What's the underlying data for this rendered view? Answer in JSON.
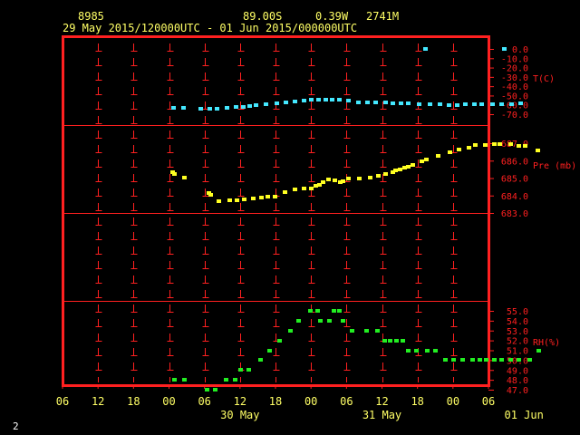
{
  "header": {
    "station": "8985",
    "lat": "89.00S",
    "lon": "0.39W",
    "elev": "2741M",
    "period": "29 May 2015/120000UTC - 01 Jun 2015/000000UTC"
  },
  "footer": {
    "page_number": "2"
  },
  "colors": {
    "frame": "#ff2020",
    "axis_text": "#ffff66",
    "tick_marks": "#ff2020",
    "temp": "#44e8ff",
    "pressure": "#ffff22",
    "rh": "#22ee22",
    "corner_text": "#ffffff"
  },
  "chart_data": {
    "type": "scatter",
    "x_axis": {
      "range_hours": [
        -6,
        66
      ],
      "tick_hours": [
        -6,
        0,
        6,
        12,
        18,
        24,
        30,
        36,
        42,
        48,
        54,
        60,
        66
      ],
      "tick_labels": [
        "06",
        "12",
        "18",
        "00",
        "06",
        "12",
        "18",
        "00",
        "06",
        "12",
        "18",
        "00",
        "06"
      ],
      "day_labels": [
        {
          "label": "30 May",
          "hour": 24
        },
        {
          "label": "31 May",
          "hour": 48
        },
        {
          "label": "01 Jun",
          "hour": 72
        }
      ]
    },
    "panels": [
      {
        "id": "temp",
        "label": "T(C)",
        "ylim": [
          -75,
          5
        ],
        "ticks": [
          0,
          -10,
          -20,
          -30,
          -40,
          -50,
          -60,
          -70
        ],
        "tick_labels": [
          "0.0",
          "-10.0",
          "-20.0",
          "-30.0",
          "-40.0",
          "-50.0",
          "-60.0",
          "-70.0"
        ],
        "points": [
          [
            12.7,
            -63.5
          ],
          [
            14.4,
            -63.5
          ],
          [
            17.3,
            -64.5
          ],
          [
            18.8,
            -64.5
          ],
          [
            20.1,
            -64
          ],
          [
            21.8,
            -63.5
          ],
          [
            23.2,
            -62.5
          ],
          [
            24.5,
            -62
          ],
          [
            25.5,
            -61.5
          ],
          [
            26.7,
            -60.5
          ],
          [
            28.3,
            -59.5
          ],
          [
            30.1,
            -58
          ],
          [
            31.7,
            -57
          ],
          [
            33.2,
            -56
          ],
          [
            34.8,
            -55
          ],
          [
            36.0,
            -54.5
          ],
          [
            37.2,
            -54
          ],
          [
            38.4,
            -54.5
          ],
          [
            39.5,
            -54.5
          ],
          [
            40.7,
            -54.5
          ],
          [
            42.2,
            -55.5
          ],
          [
            43.9,
            -57
          ],
          [
            45.5,
            -57
          ],
          [
            46.9,
            -57
          ],
          [
            48.5,
            -57.5
          ],
          [
            49.8,
            -58
          ],
          [
            51.2,
            -58
          ],
          [
            52.4,
            -58
          ],
          [
            54.2,
            -59
          ],
          [
            56.0,
            -59
          ],
          [
            57.7,
            -59.5
          ],
          [
            59.2,
            -60
          ],
          [
            60.6,
            -60
          ],
          [
            62.0,
            -59.5
          ],
          [
            63.5,
            -59.5
          ],
          [
            64.8,
            -59.5
          ],
          [
            66.6,
            -59.5
          ],
          [
            68.2,
            -59
          ],
          [
            69.8,
            -59
          ],
          [
            71.4,
            -58.5
          ],
          [
            55.3,
            0
          ],
          [
            68.6,
            0
          ]
        ]
      },
      {
        "id": "pressure",
        "label": "Pre (mb)",
        "ylim": [
          682.7,
          687.5
        ],
        "ticks": [
          687,
          686,
          685,
          684,
          683
        ],
        "tick_labels": [
          "687.0",
          "686.0",
          "685.0",
          "684.0",
          "683.0"
        ],
        "points": [
          [
            12.5,
            685.35
          ],
          [
            12.9,
            685.25
          ],
          [
            14.6,
            685.05
          ],
          [
            18.6,
            684.15
          ],
          [
            18.9,
            684.05
          ],
          [
            20.3,
            683.7
          ],
          [
            22.2,
            683.75
          ],
          [
            23.4,
            683.75
          ],
          [
            24.7,
            683.8
          ],
          [
            26.2,
            683.85
          ],
          [
            27.5,
            683.9
          ],
          [
            28.6,
            683.95
          ],
          [
            29.8,
            683.95
          ],
          [
            31.5,
            684.2
          ],
          [
            33.2,
            684.35
          ],
          [
            34.8,
            684.4
          ],
          [
            35.9,
            684.4
          ],
          [
            36.8,
            684.55
          ],
          [
            37.3,
            684.6
          ],
          [
            38.0,
            684.75
          ],
          [
            38.9,
            684.9
          ],
          [
            40.0,
            684.85
          ],
          [
            40.9,
            684.75
          ],
          [
            41.3,
            684.8
          ],
          [
            42.2,
            684.95
          ],
          [
            44.1,
            684.95
          ],
          [
            46.0,
            685.05
          ],
          [
            47.3,
            685.15
          ],
          [
            48.5,
            685.25
          ],
          [
            49.7,
            685.35
          ],
          [
            50.2,
            685.45
          ],
          [
            51.0,
            685.5
          ],
          [
            51.7,
            685.6
          ],
          [
            52.3,
            685.65
          ],
          [
            53.2,
            685.75
          ],
          [
            54.7,
            685.95
          ],
          [
            55.4,
            686.05
          ],
          [
            57.4,
            686.25
          ],
          [
            59.4,
            686.5
          ],
          [
            60.9,
            686.65
          ],
          [
            62.6,
            686.75
          ],
          [
            63.7,
            686.9
          ],
          [
            65.4,
            686.9
          ],
          [
            66.9,
            686.95
          ],
          [
            67.9,
            686.95
          ],
          [
            69.6,
            686.95
          ],
          [
            71.1,
            686.85
          ],
          [
            72.1,
            686.85
          ],
          [
            74.2,
            686.6
          ]
        ]
      },
      {
        "id": "rh",
        "label": "RH(%)",
        "ylim": [
          46.8,
          56.0
        ],
        "ticks": [
          55,
          54,
          53,
          52,
          51,
          50,
          49,
          48,
          47
        ],
        "tick_labels": [
          "55.0",
          "54.0",
          "53.0",
          "52.0",
          "51.0",
          "50.0",
          "49.0",
          "48.0",
          "47.0"
        ],
        "points": [
          [
            12.8,
            48
          ],
          [
            14.5,
            48
          ],
          [
            18.3,
            47
          ],
          [
            19.7,
            47
          ],
          [
            21.6,
            48
          ],
          [
            23.1,
            48
          ],
          [
            24.0,
            49
          ],
          [
            25.4,
            49
          ],
          [
            27.4,
            50
          ],
          [
            28.9,
            51
          ],
          [
            30.6,
            52
          ],
          [
            32.4,
            53
          ],
          [
            33.9,
            54
          ],
          [
            35.8,
            55
          ],
          [
            37.0,
            55
          ],
          [
            37.5,
            54
          ],
          [
            39.1,
            54
          ],
          [
            39.8,
            55
          ],
          [
            40.7,
            55
          ],
          [
            41.4,
            54
          ],
          [
            42.8,
            53
          ],
          [
            45.3,
            53
          ],
          [
            47.1,
            53
          ],
          [
            48.4,
            52
          ],
          [
            49.3,
            52
          ],
          [
            50.4,
            52
          ],
          [
            51.4,
            52
          ],
          [
            52.3,
            51
          ],
          [
            53.8,
            51
          ],
          [
            55.6,
            51
          ],
          [
            56.9,
            51
          ],
          [
            58.7,
            50
          ],
          [
            60.0,
            50
          ],
          [
            61.5,
            50
          ],
          [
            63.3,
            50
          ],
          [
            64.5,
            50
          ],
          [
            65.6,
            50
          ],
          [
            66.9,
            50
          ],
          [
            68.2,
            50
          ],
          [
            69.6,
            50
          ],
          [
            71.0,
            50
          ],
          [
            72.9,
            50
          ],
          [
            74.4,
            51
          ]
        ]
      }
    ]
  }
}
